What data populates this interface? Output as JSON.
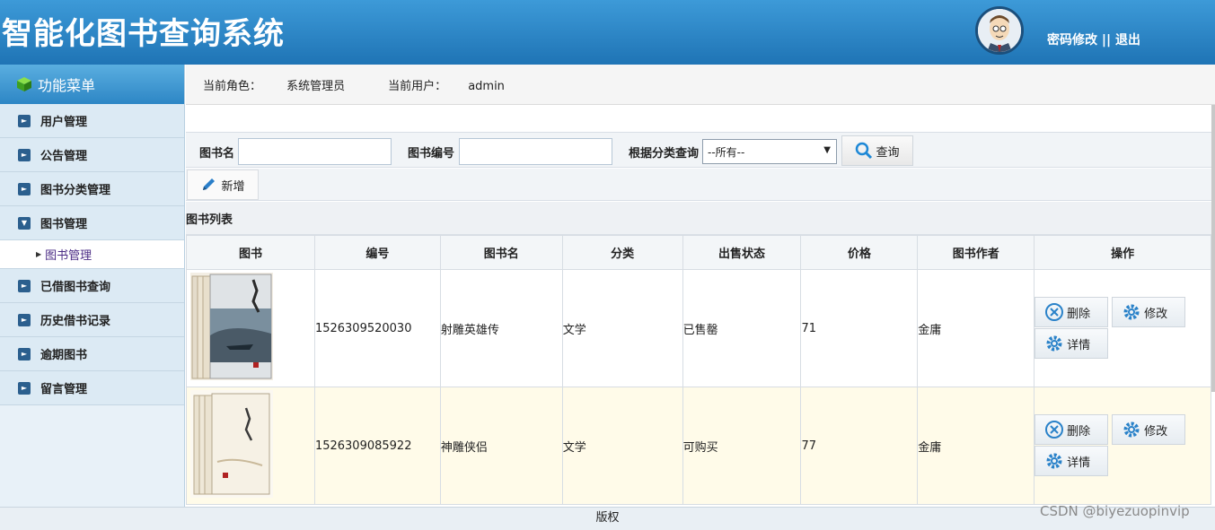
{
  "header": {
    "title": "智能化图书查询系统",
    "change_password": "密码修改",
    "separator": " || ",
    "logout": "退出"
  },
  "sidebar": {
    "title": "功能菜单",
    "items": [
      {
        "label": "用户管理"
      },
      {
        "label": "公告管理"
      },
      {
        "label": "图书分类管理"
      },
      {
        "label": "图书管理",
        "expanded": true
      },
      {
        "label": "已借图书查询"
      },
      {
        "label": "历史借书记录"
      },
      {
        "label": "逾期图书"
      },
      {
        "label": "留言管理"
      }
    ],
    "sub_item": "图书管理"
  },
  "info": {
    "role_label": "当前角色：",
    "role_value": "系统管理员",
    "user_label": "当前用户：",
    "user_value": "admin"
  },
  "search": {
    "book_name_label": "图书名",
    "book_name_value": "",
    "book_no_label": "图书编号",
    "book_no_value": "",
    "category_label": "根据分类查询",
    "category_selected": "--所有--",
    "query_button": "查询"
  },
  "toolbar": {
    "add_button": "新增"
  },
  "list": {
    "title": "图书列表",
    "columns": [
      "图书",
      "编号",
      "图书名",
      "分类",
      "出售状态",
      "价格",
      "图书作者",
      "操作"
    ],
    "rows": [
      {
        "no": "1526309520030",
        "name": "射雕英雄传",
        "category": "文学",
        "status": "已售罄",
        "price": "71",
        "author": "金庸"
      },
      {
        "no": "1526309085922",
        "name": "神雕侠侣",
        "category": "文学",
        "status": "可购买",
        "price": "77",
        "author": "金庸"
      }
    ],
    "actions": {
      "delete": "删除",
      "edit": "修改",
      "detail": "详情"
    }
  },
  "footer": {
    "text": "版权"
  },
  "watermark": "CSDN @biyezuopinvip"
}
